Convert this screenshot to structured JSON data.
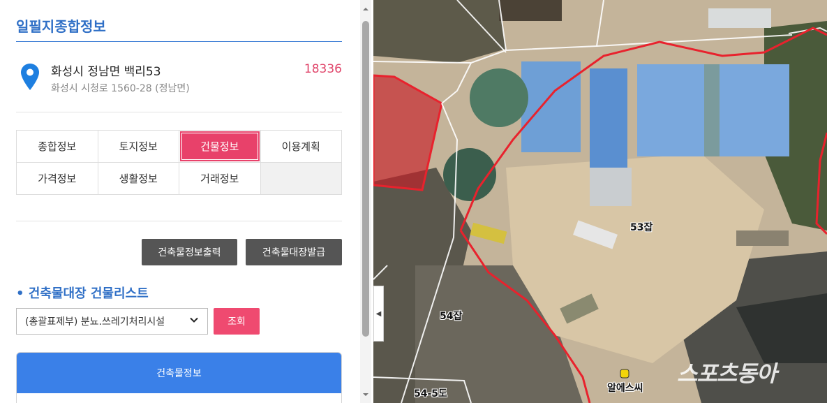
{
  "panel": {
    "title": "일필지종합정보",
    "address_main": "화성시 정남면 백리53",
    "address_sub": "화성시 시청로 1560-28 (정남면)",
    "zip": "18336",
    "tabs": [
      "종합정보",
      "토지정보",
      "건물정보",
      "이용계획",
      "가격정보",
      "생활정보",
      "거래정보"
    ],
    "active_tab": "건물정보",
    "btn_print": "건축물정보출력",
    "btn_issue": "건축물대장발급",
    "list_title": "• 건축물대장 건물리스트",
    "select_value": "(총괄표제부) 분뇨.쓰레기처리시설",
    "btn_search": "조회",
    "info_header": "건축물정보"
  },
  "map": {
    "labels": [
      "53잡",
      "54잡",
      "54-5도",
      "알에스씨"
    ],
    "watermark": "스포츠동아"
  },
  "colors": {
    "accent_blue": "#2f6fc6",
    "accent_pink": "#e8416a",
    "parcel_red": "#e8222d"
  }
}
